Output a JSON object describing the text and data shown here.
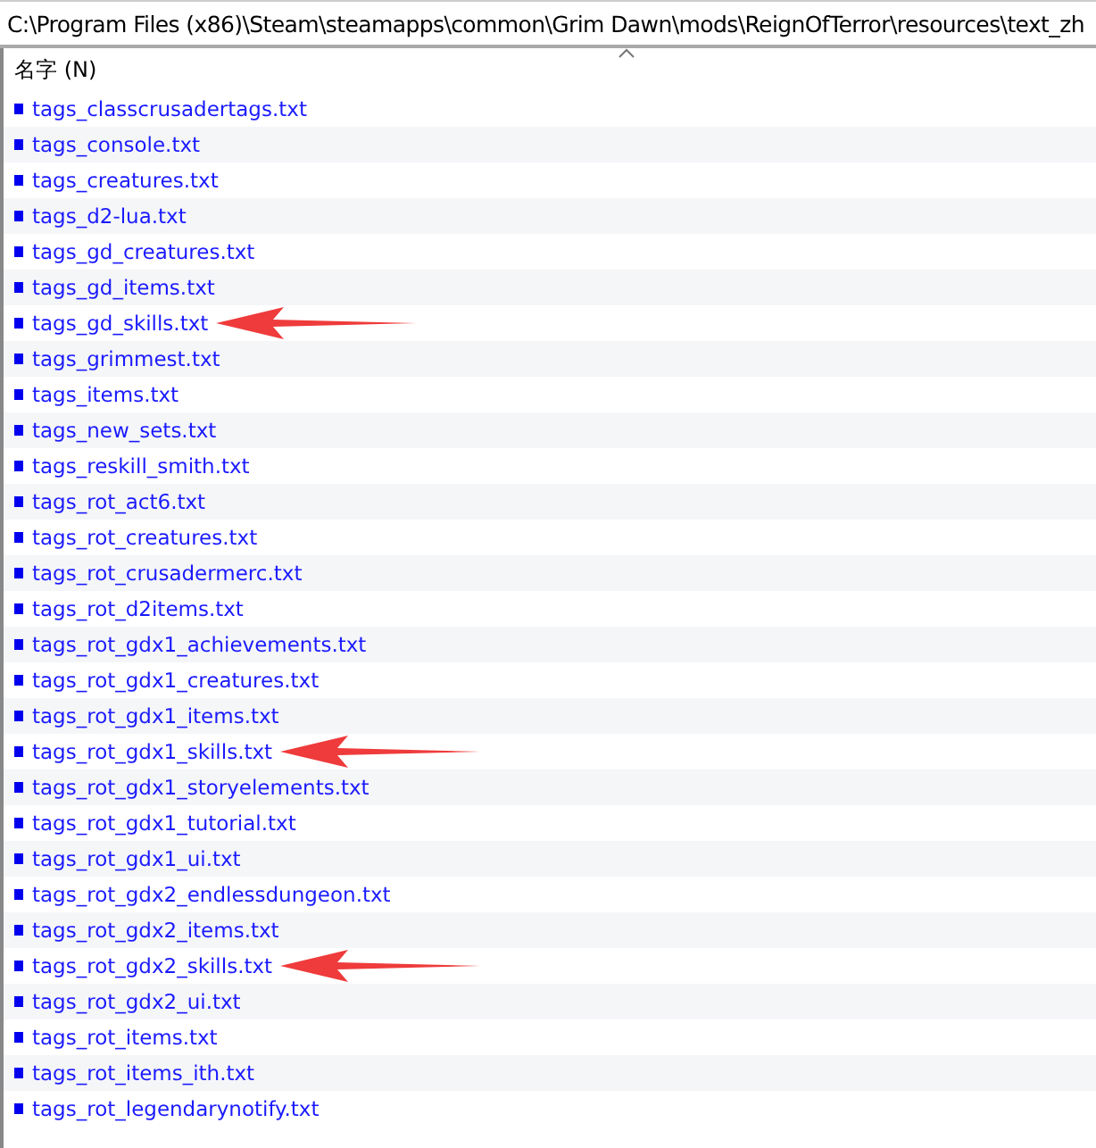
{
  "path_bar": {
    "value": "C:\\Program Files (x86)\\Steam\\steamapps\\common\\Grim Dawn\\mods\\ReignOfTerror\\resources\\text_zh"
  },
  "column_header": {
    "label": "名字 (N)"
  },
  "files": [
    {
      "name": "tags_classcrusadertags.txt",
      "arrow": false
    },
    {
      "name": "tags_console.txt",
      "arrow": false
    },
    {
      "name": "tags_creatures.txt",
      "arrow": false
    },
    {
      "name": "tags_d2-lua.txt",
      "arrow": false
    },
    {
      "name": "tags_gd_creatures.txt",
      "arrow": false
    },
    {
      "name": "tags_gd_items.txt",
      "arrow": false
    },
    {
      "name": "tags_gd_skills.txt",
      "arrow": true
    },
    {
      "name": "tags_grimmest.txt",
      "arrow": false
    },
    {
      "name": "tags_items.txt",
      "arrow": false
    },
    {
      "name": "tags_new_sets.txt",
      "arrow": false
    },
    {
      "name": "tags_reskill_smith.txt",
      "arrow": false
    },
    {
      "name": "tags_rot_act6.txt",
      "arrow": false
    },
    {
      "name": "tags_rot_creatures.txt",
      "arrow": false
    },
    {
      "name": "tags_rot_crusadermerc.txt",
      "arrow": false
    },
    {
      "name": "tags_rot_d2items.txt",
      "arrow": false
    },
    {
      "name": "tags_rot_gdx1_achievements.txt",
      "arrow": false
    },
    {
      "name": "tags_rot_gdx1_creatures.txt",
      "arrow": false
    },
    {
      "name": "tags_rot_gdx1_items.txt",
      "arrow": false
    },
    {
      "name": "tags_rot_gdx1_skills.txt",
      "arrow": true
    },
    {
      "name": "tags_rot_gdx1_storyelements.txt",
      "arrow": false
    },
    {
      "name": "tags_rot_gdx1_tutorial.txt",
      "arrow": false
    },
    {
      "name": "tags_rot_gdx1_ui.txt",
      "arrow": false
    },
    {
      "name": "tags_rot_gdx2_endlessdungeon.txt",
      "arrow": false
    },
    {
      "name": "tags_rot_gdx2_items.txt",
      "arrow": false
    },
    {
      "name": "tags_rot_gdx2_skills.txt",
      "arrow": true
    },
    {
      "name": "tags_rot_gdx2_ui.txt",
      "arrow": false
    },
    {
      "name": "tags_rot_items.txt",
      "arrow": false
    },
    {
      "name": "tags_rot_items_ith.txt",
      "arrow": false
    },
    {
      "name": "tags_rot_legendarynotify.txt",
      "arrow": false
    }
  ]
}
